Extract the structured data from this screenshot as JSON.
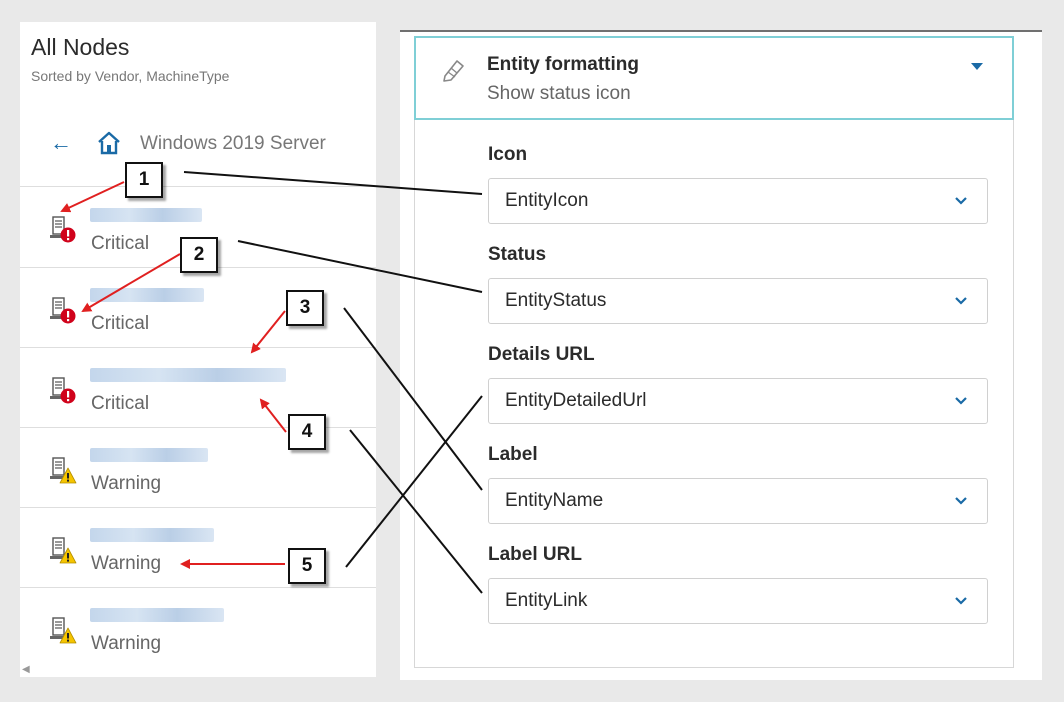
{
  "left_panel": {
    "title": "All Nodes",
    "subtitle": "Sorted by Vendor, MachineType",
    "breadcrumb": "Windows 2019 Server",
    "nodes": [
      {
        "status": "Critical",
        "status_icon": "critical-icon"
      },
      {
        "status": "Critical",
        "status_icon": "critical-icon"
      },
      {
        "status": "Critical",
        "status_icon": "critical-icon"
      },
      {
        "status": "Warning",
        "status_icon": "warning-icon"
      },
      {
        "status": "Warning",
        "status_icon": "warning-icon"
      },
      {
        "status": "Warning",
        "status_icon": "warning-icon"
      }
    ]
  },
  "entity_formatting": {
    "title": "Entity formatting",
    "subtitle": "Show status icon",
    "fields": [
      {
        "label": "Icon",
        "value": "EntityIcon"
      },
      {
        "label": "Status",
        "value": "EntityStatus"
      },
      {
        "label": "Details URL",
        "value": "EntityDetailedUrl"
      },
      {
        "label": "Label",
        "value": "EntityName"
      },
      {
        "label": "Label URL",
        "value": "EntityLink"
      }
    ]
  },
  "callouts": [
    "1",
    "2",
    "3",
    "4",
    "5"
  ],
  "colors": {
    "accent": "#1a6aa6",
    "header_border": "#7fcfd6",
    "critical": "#d0021b",
    "warning": "#f5c400",
    "arrow": "#e02020"
  }
}
